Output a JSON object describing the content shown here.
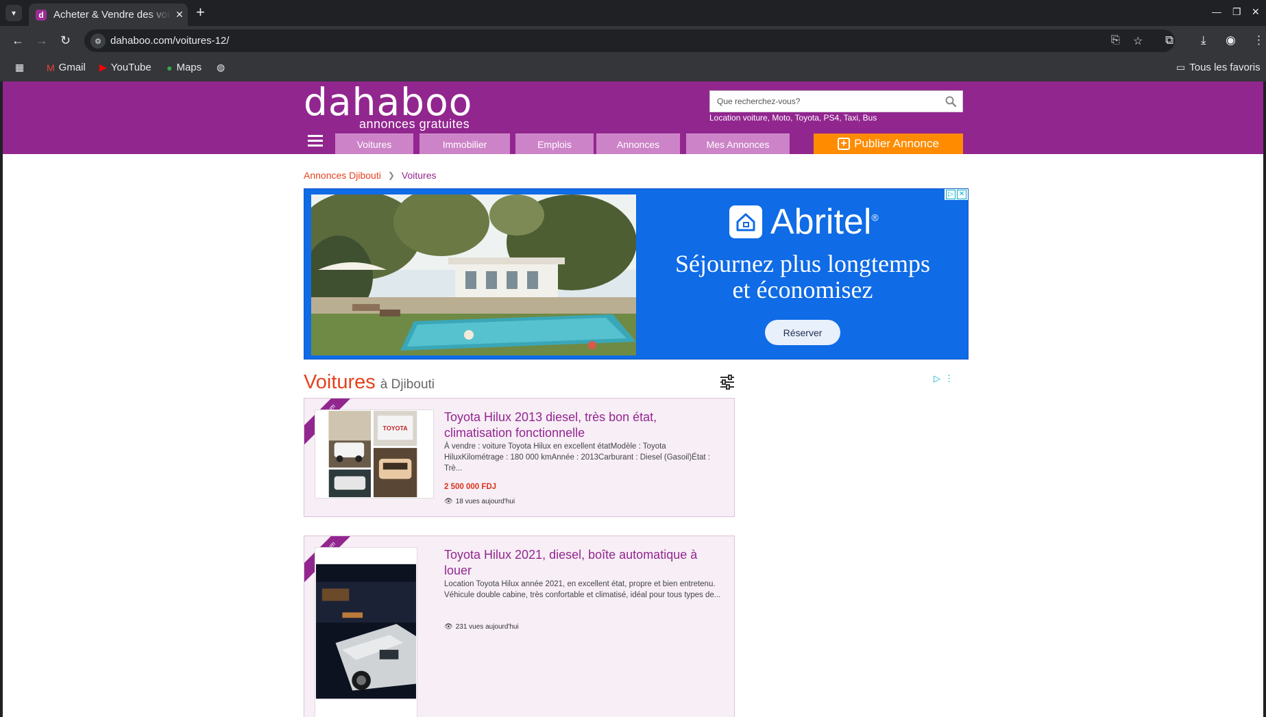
{
  "browser": {
    "tab_title": "Acheter & Vendre des voitures",
    "url": "dahaboo.com/voitures-12/",
    "bookmarks": [
      "Gmail",
      "YouTube",
      "Maps"
    ],
    "all_bookmarks": "Tous les favoris"
  },
  "header": {
    "logo_word": "dahaboo",
    "logo_tagline": "annonces gratuites",
    "search_placeholder": "Que recherchez-vous?",
    "search_hint": "Location voiture, Moto, Toyota, PS4, Taxi, Bus",
    "nav": [
      "Voitures",
      "Immobilier",
      "Emplois",
      "Annonces",
      "Mes Annonces"
    ],
    "publish_label": "Publier Annonce",
    "brand_color": "#92268f",
    "accent_color": "#ff8c00"
  },
  "breadcrumb": {
    "home": "Annonces Djibouti",
    "current": "Voitures"
  },
  "ad": {
    "brand": "Abritel",
    "reg_mark": "®",
    "headline_line1": "Séjournez plus longtemps",
    "headline_line2": "et économisez",
    "cta": "Réserver",
    "bg_color": "#0f6be6"
  },
  "section": {
    "title": "Voitures",
    "subtitle": "à Djibouti"
  },
  "listings": [
    {
      "badge": "Premium",
      "title": "Toyota Hilux 2013 diesel, très bon état, climatisation fonctionnelle",
      "description": "À vendre : voiture Toyota Hilux en excellent étatModèle : Toyota HiluxKilométrage : 180 000 kmAnnée : 2013Carburant : Diesel (Gasoil)État : Trè...",
      "price": "2 500 000 FDJ",
      "views": "18 vues aujourd'hui",
      "photo_text": "TOYOTA"
    },
    {
      "badge": "Premium",
      "title": "Toyota Hilux 2021, diesel, boîte automatique à louer",
      "description": "Location Toyota Hilux année 2021, en excellent état, propre et bien entretenu. Véhicule double cabine, très confortable et climatisé, idéal pour tous types de...",
      "views": "231 vues aujourd'hui"
    }
  ]
}
